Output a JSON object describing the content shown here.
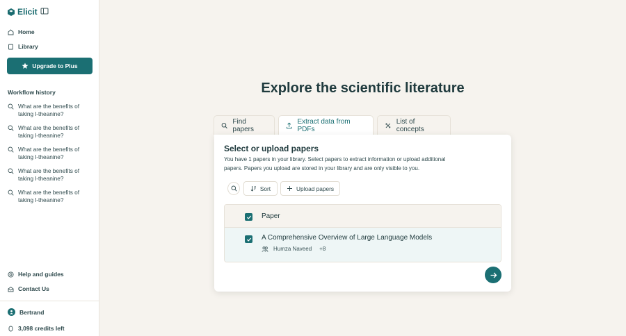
{
  "sidebar": {
    "brand": "Elicit",
    "nav": [
      {
        "label": "Home",
        "icon": "home-icon"
      },
      {
        "label": "Library",
        "icon": "book-icon"
      }
    ],
    "upgrade_label": "Upgrade to Plus",
    "history_label": "Workflow history",
    "history": [
      {
        "line1": "What are the benefits of",
        "line2": "taking l-theanine?"
      },
      {
        "line1": "What are the benefits of",
        "line2": "taking l-theanine?"
      },
      {
        "line1": "What are the benefits of",
        "line2": "taking l-theanine?"
      },
      {
        "line1": "What are the benefits of",
        "line2": "taking l-theanine?"
      },
      {
        "line1": "What are the benefits of",
        "line2": "taking l-theanine?"
      }
    ],
    "bottom": [
      {
        "label": "Help and guides",
        "icon": "help-icon"
      },
      {
        "label": "Contact Us",
        "icon": "contact-icon"
      }
    ],
    "user": "Bertrand",
    "credits": "3,098 credits left"
  },
  "main": {
    "title": "Explore the scientific literature",
    "tabs": [
      {
        "label": "Find papers",
        "icon": "search-icon"
      },
      {
        "label": "Extract data from PDFs",
        "icon": "upload-icon",
        "active": true
      },
      {
        "label": "List of concepts",
        "icon": "concepts-icon"
      }
    ],
    "panel": {
      "title": "Select or upload papers",
      "desc_line1": "You have 1 papers in your library. Select papers to extract information or upload additional",
      "desc_line2": "papers. Papers you upload are stored in your library and are only visible to you.",
      "sort_label": "Sort",
      "upload_label": "Upload papers",
      "column_header": "Paper",
      "rows": [
        {
          "title": "A Comprehensive Overview of Large Language Models",
          "author": "Humza Naveed",
          "more": "+8",
          "checked": true
        }
      ]
    }
  },
  "colors": {
    "accent": "#1b6f73",
    "background": "#f6f3ee",
    "text": "#1f3a3d"
  }
}
